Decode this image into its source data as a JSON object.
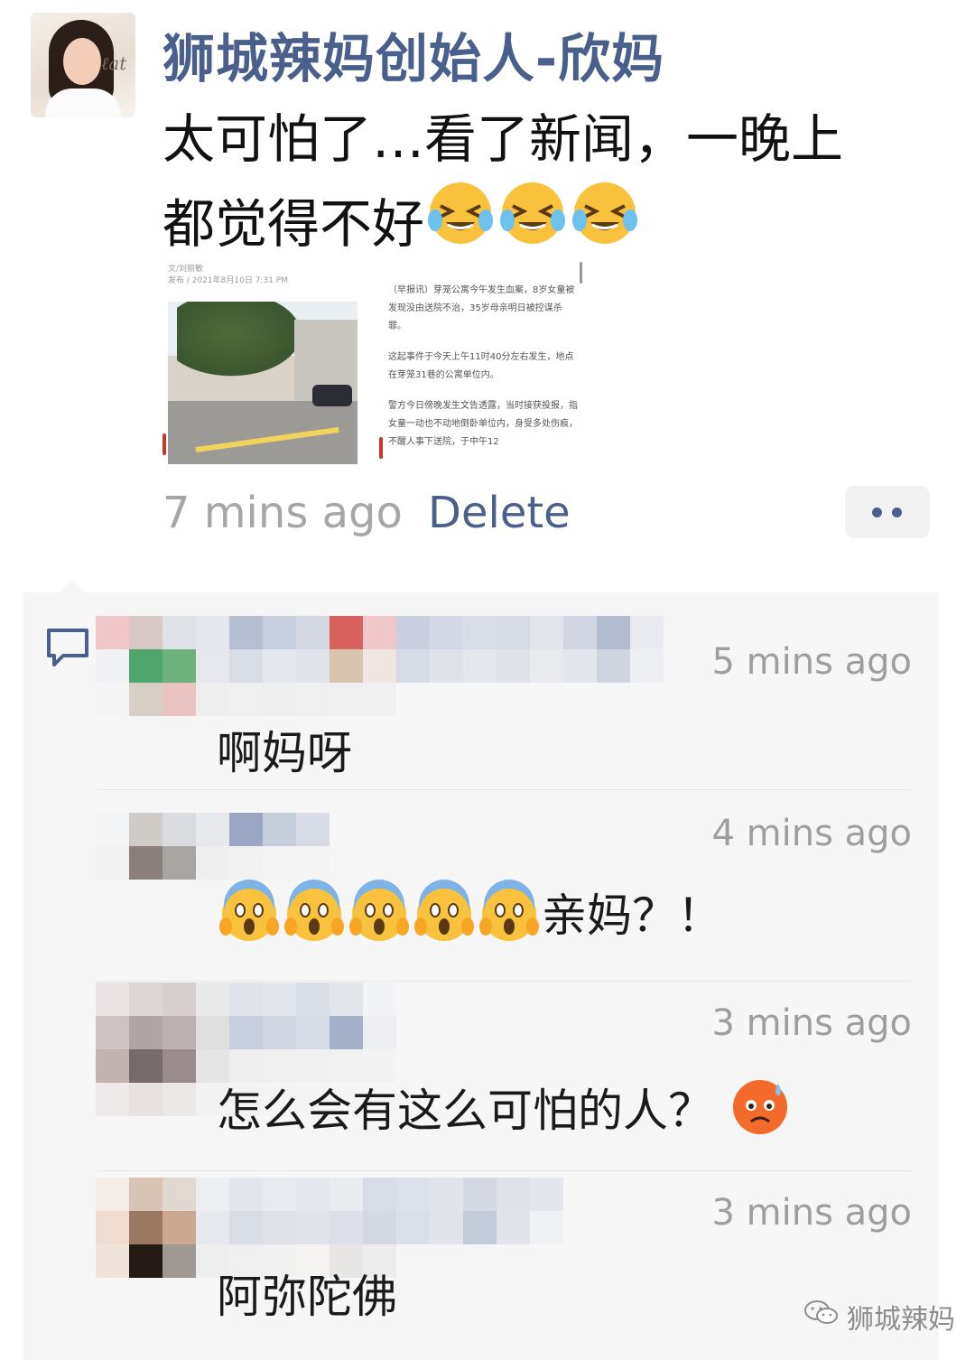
{
  "post": {
    "author": "狮城辣妈创始人-欣妈",
    "text_line1": "太可怕了…看了新闻，一晚上",
    "text_line2": "都觉得不好",
    "emojis": [
      "tears-of-joy-emoji",
      "tears-of-joy-emoji",
      "tears-of-joy-emoji"
    ],
    "timestamp": "7 mins ago",
    "delete_label": "Delete"
  },
  "news_card": {
    "byline_1": "文/刘丽敏",
    "byline_2": "发布 / 2021年8月10日 7:31 PM",
    "para_1": "（早报讯）芽笼公寓今午发生血案，8岁女童被发现没由送院不治，35岁母亲明日被控谋杀罪。",
    "para_2": "这起事件于今天上午11时40分左右发生，地点在芽笼31巷的公寓单位内。",
    "para_3": "警方今日傍晚发生文告透露，当时接获投报，指女童一动也不动地倒卧单位内，身受多处伤痕，不醒人事下送院，于中午12"
  },
  "comments": [
    {
      "time": "5 mins ago",
      "text": "啊妈呀"
    },
    {
      "time": "4 mins ago",
      "text": "亲妈？！"
    },
    {
      "time": "3 mins ago",
      "text": "怎么会有这么可怕的人？"
    },
    {
      "time": "3 mins ago",
      "text": "阿弥陀佛"
    }
  ],
  "watermark": "狮城辣妈",
  "colors": {
    "link": "#4a5f8c",
    "timestamp": "#a6a6a6",
    "comment_bg": "#f6f6f6"
  }
}
